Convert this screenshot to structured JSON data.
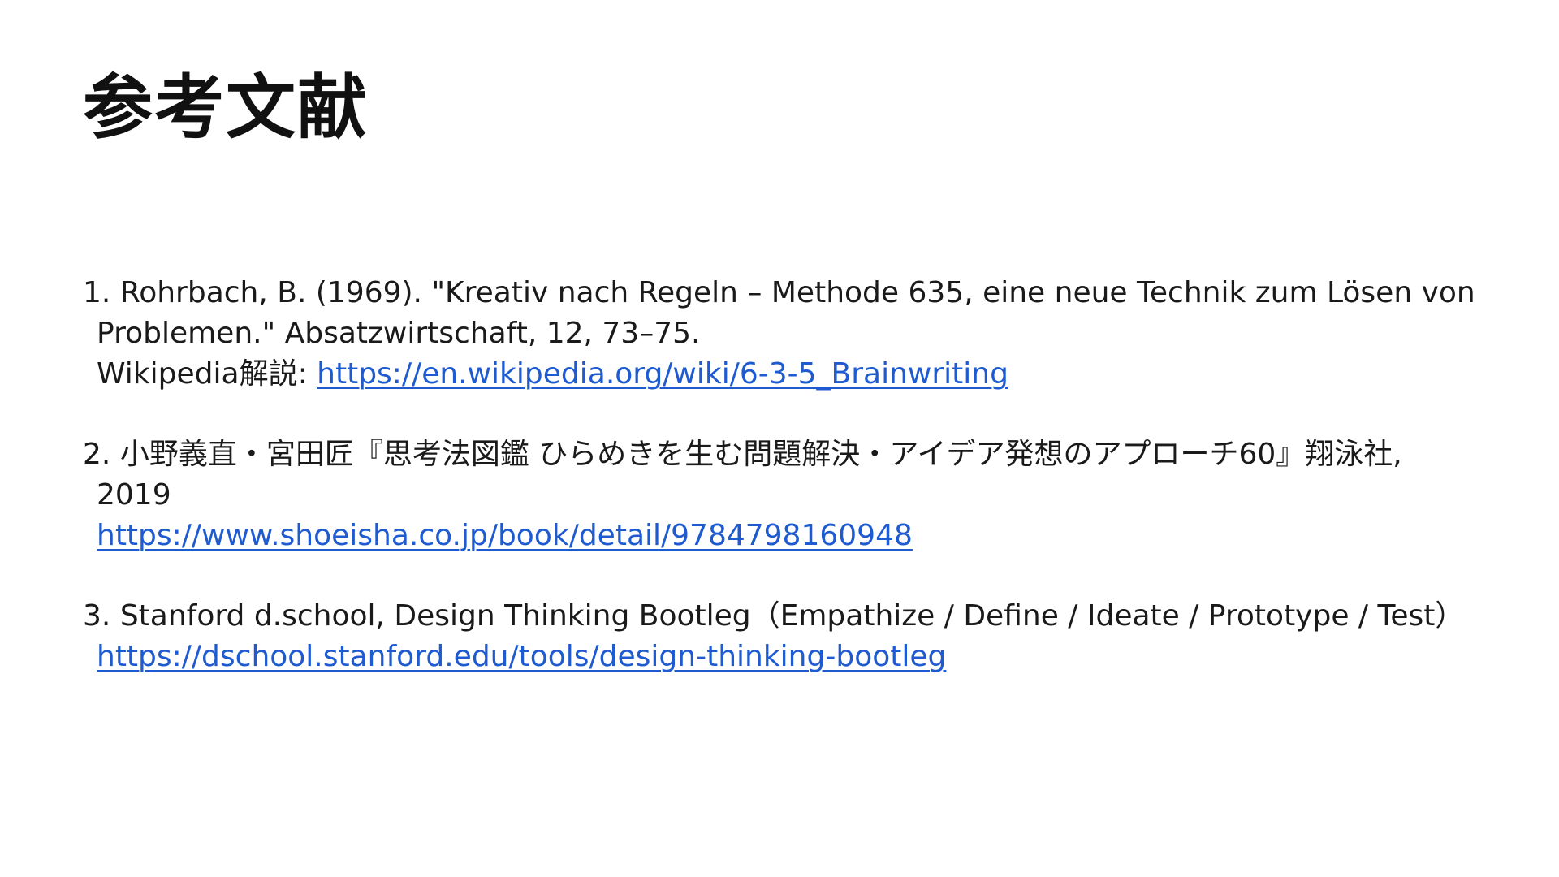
{
  "title": "参考文献",
  "references": [
    {
      "number": "1.",
      "line1": "Rohrbach, B. (1969). \"Kreativ nach Regeln – Methode 635, eine neue Technik zum Lösen von",
      "line2": "Problemen.\" Absatzwirtschaft, 12, 73–75.",
      "line3_prefix": "Wikipedia解説: ",
      "link": "https://en.wikipedia.org/wiki/6-3-5_Brainwriting"
    },
    {
      "number": "2.",
      "line1": "小野義直・宮田匠『思考法図鑑 ひらめきを生む問題解決・アイデア発想のアプローチ60』翔泳社,",
      "line2": "2019",
      "link": "https://www.shoeisha.co.jp/book/detail/9784798160948"
    },
    {
      "number": "3.",
      "line1": "Stanford d.school, Design Thinking Bootleg（Empathize / Define / Ideate / Prototype / Test）",
      "link": "https://dschool.stanford.edu/tools/design-thinking-bootleg"
    }
  ],
  "colors": {
    "link": "#1f5bd0",
    "text": "#1a1a1a",
    "background": "#ffffff"
  }
}
